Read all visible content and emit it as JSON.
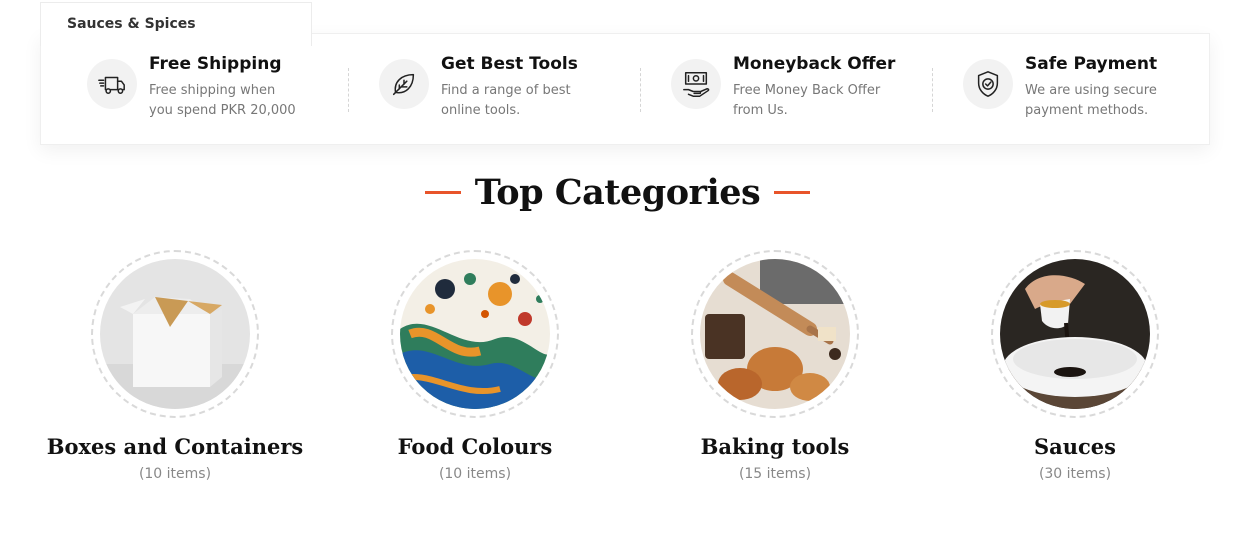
{
  "dropdown": {
    "label": "Sauces & Spices"
  },
  "features": [
    {
      "title": "Free Shipping",
      "description": "Free shipping when you spend PKR 20,000",
      "icon": "delivery-truck-icon"
    },
    {
      "title": "Get Best Tools",
      "description": "Find a range of best online tools.",
      "icon": "leaf-icon"
    },
    {
      "title": "Moneyback Offer",
      "description": "Free Money Back Offer from Us.",
      "icon": "money-hand-icon"
    },
    {
      "title": "Safe Payment",
      "description": "We are using secure payment methods.",
      "icon": "shield-check-icon"
    }
  ],
  "section": {
    "title": "Top Categories",
    "accent_color": "#e8542a"
  },
  "categories": [
    {
      "name": "Boxes and Containers",
      "count": "(10 items)"
    },
    {
      "name": "Food Colours",
      "count": "(10 items)"
    },
    {
      "name": "Baking tools",
      "count": "(15 items)"
    },
    {
      "name": "Sauces",
      "count": "(30 items)"
    }
  ]
}
